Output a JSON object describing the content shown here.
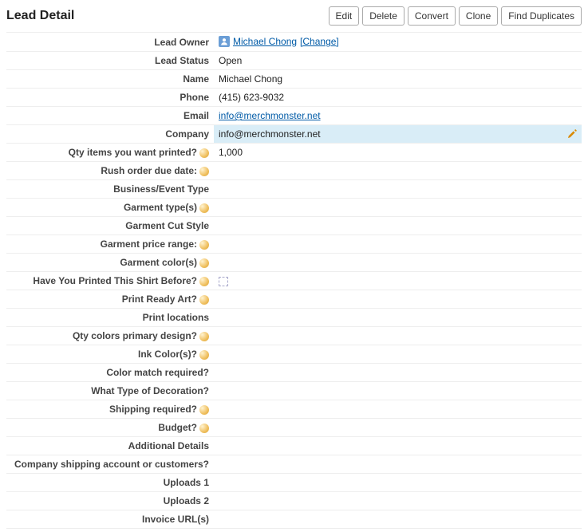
{
  "header": {
    "title": "Lead Detail",
    "buttons": {
      "edit": "Edit",
      "delete": "Delete",
      "convert": "Convert",
      "clone": "Clone",
      "findDuplicates": "Find Duplicates"
    }
  },
  "owner": {
    "label": "Lead Owner",
    "name": "Michael Chong",
    "changeLabel": "[Change]"
  },
  "fields": {
    "leadStatus": {
      "label": "Lead Status",
      "value": "Open"
    },
    "name": {
      "label": "Name",
      "value": "Michael Chong"
    },
    "phone": {
      "label": "Phone",
      "value": "(415) 623-9032"
    },
    "email": {
      "label": "Email",
      "value": "info@merchmonster.net"
    },
    "company": {
      "label": "Company",
      "value": "info@merchmonster.net"
    },
    "qtyItems": {
      "label": "Qty items you want printed?",
      "value": "1,000"
    },
    "rushOrder": {
      "label": "Rush order due date:",
      "value": ""
    },
    "businessEventType": {
      "label": "Business/Event Type",
      "value": ""
    },
    "garmentTypes": {
      "label": "Garment type(s)",
      "value": ""
    },
    "garmentCutStyle": {
      "label": "Garment Cut Style",
      "value": ""
    },
    "garmentPriceRange": {
      "label": "Garment price range:",
      "value": ""
    },
    "garmentColors": {
      "label": "Garment color(s)",
      "value": ""
    },
    "printedBefore": {
      "label": "Have You Printed This Shirt Before?",
      "value": ""
    },
    "printReadyArt": {
      "label": "Print Ready Art?",
      "value": ""
    },
    "printLocations": {
      "label": "Print locations",
      "value": ""
    },
    "qtyColorsPrimary": {
      "label": "Qty colors primary design?",
      "value": ""
    },
    "inkColors": {
      "label": "Ink Color(s)?",
      "value": ""
    },
    "colorMatch": {
      "label": "Color match required?",
      "value": ""
    },
    "decorationType": {
      "label": "What Type of Decoration?",
      "value": ""
    },
    "shippingRequired": {
      "label": "Shipping required?",
      "value": ""
    },
    "budget": {
      "label": "Budget?",
      "value": ""
    },
    "additionalDetails": {
      "label": "Additional Details",
      "value": ""
    },
    "shippingAccount": {
      "label": "Company shipping account or customers?",
      "value": ""
    },
    "uploads1": {
      "label": "Uploads 1",
      "value": ""
    },
    "uploads2": {
      "label": "Uploads 2",
      "value": ""
    },
    "invoiceUrls": {
      "label": "Invoice URL(s)",
      "value": ""
    }
  }
}
